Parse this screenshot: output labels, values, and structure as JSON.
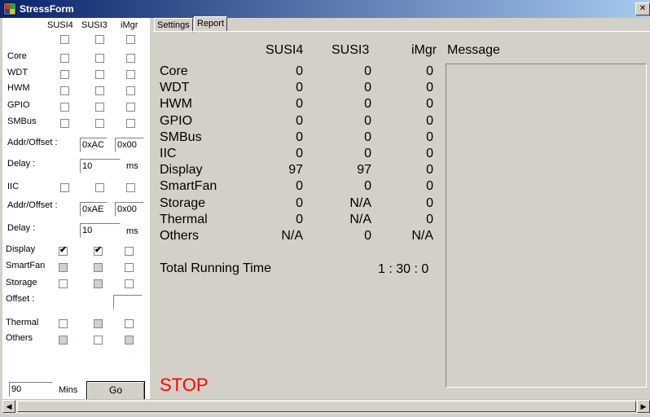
{
  "window": {
    "title": "StressForm"
  },
  "left": {
    "col_headers": [
      "SUSI4",
      "SUSI3",
      "iMgr"
    ],
    "labels": {
      "core": "Core",
      "wdt": "WDT",
      "hwm": "HWM",
      "gpio": "GPIO",
      "smbus": "SMBus",
      "addr_offset_1": "Addr/Offset :",
      "delay_1": "Delay :",
      "iic": "IIC",
      "addr_offset_2": "Addr/Offset :",
      "delay_2": "Delay :",
      "display": "Display",
      "smartfan": "SmartFan",
      "storage": "Storage",
      "offset": "Offset :",
      "thermal": "Thermal",
      "others": "Others",
      "ms_1": "ms",
      "ms_2": "ms",
      "mins": "Mins"
    },
    "smbus_addr": "0xAC",
    "smbus_offset": "0x00",
    "smbus_delay": "10",
    "iic_addr": "0xAE",
    "iic_offset": "0x00",
    "iic_delay": "10",
    "storage_offset": "",
    "minutes": "90",
    "go_label": "Go"
  },
  "tabs": [
    "Settings",
    "Report"
  ],
  "report": {
    "headers": [
      "SUSI4",
      "SUSI3",
      "iMgr"
    ],
    "message_label": "Message",
    "rows": [
      {
        "name": "Core",
        "v": [
          "0",
          "0",
          "0"
        ]
      },
      {
        "name": "WDT",
        "v": [
          "0",
          "0",
          "0"
        ]
      },
      {
        "name": "HWM",
        "v": [
          "0",
          "0",
          "0"
        ]
      },
      {
        "name": "GPIO",
        "v": [
          "0",
          "0",
          "0"
        ]
      },
      {
        "name": "SMBus",
        "v": [
          "0",
          "0",
          "0"
        ]
      },
      {
        "name": "IIC",
        "v": [
          "0",
          "0",
          "0"
        ]
      },
      {
        "name": "Display",
        "v": [
          "97",
          "97",
          "0"
        ]
      },
      {
        "name": "SmartFan",
        "v": [
          "0",
          "0",
          "0"
        ]
      },
      {
        "name": "Storage",
        "v": [
          "0",
          "N/A",
          "0"
        ]
      },
      {
        "name": "Thermal",
        "v": [
          "0",
          "N/A",
          "0"
        ]
      },
      {
        "name": "Others",
        "v": [
          "N/A",
          "0",
          "N/A"
        ]
      }
    ],
    "total_label": "Total Running Time",
    "total_value": "1 : 30 : 0",
    "stop_label": "STOP",
    "stop_color": "#ff0000"
  }
}
